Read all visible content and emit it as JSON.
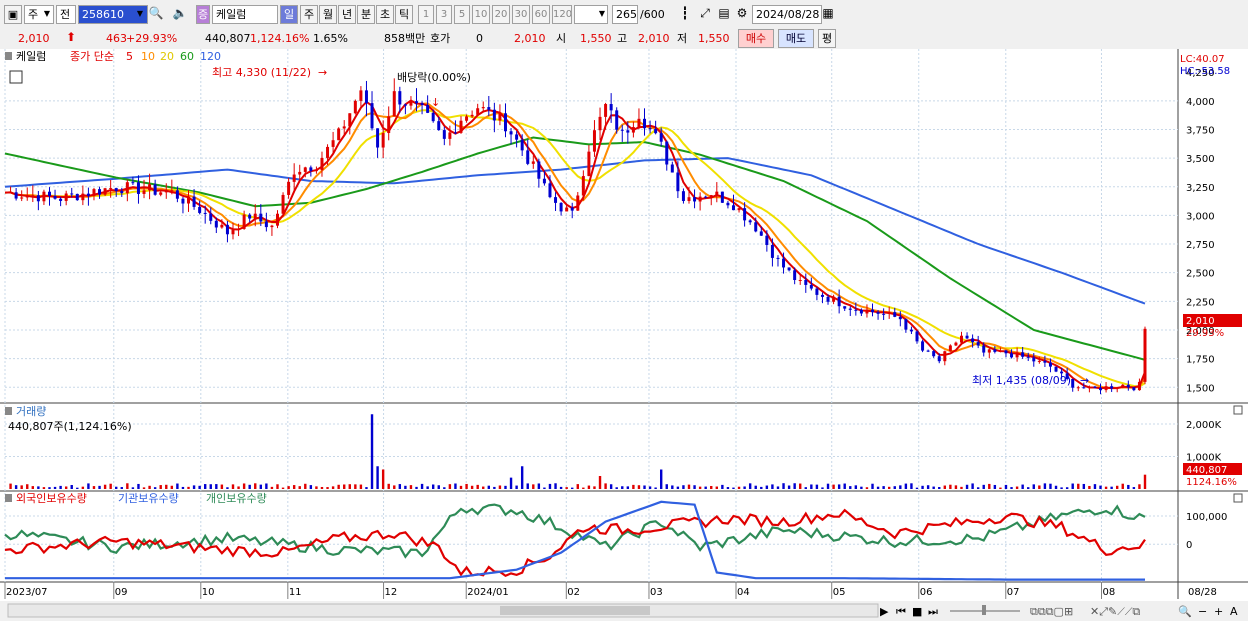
{
  "toolbar": {
    "market": "주",
    "prev_label": "전",
    "code": "258610",
    "stock_badge": "증",
    "stock_name": "케일럼",
    "periods": [
      "일",
      "주",
      "월",
      "년",
      "분",
      "초",
      "틱"
    ],
    "active_period": "일",
    "nums": [
      "1",
      "3",
      "5",
      "10",
      "20",
      "30",
      "60",
      "120"
    ],
    "count": "265",
    "count_total": "/600",
    "date": "2024/08/28"
  },
  "info": {
    "price": "2,010",
    "change": "463",
    "change_pct": "+29.93%",
    "volume": "440,807",
    "volume_pct": "1,124.16%",
    "turnover": "1.65%",
    "amount": "858백만",
    "hoga_label": "호가",
    "hoga_value": "0",
    "hoga_price": "2,010",
    "open_label": "시",
    "open": "1,550",
    "high_label": "고",
    "high": "2,010",
    "low_label": "저",
    "low": "1,550",
    "buy_label": "매수",
    "sell_label": "매도",
    "eval_label": "평"
  },
  "colors": {
    "up": "#e00000",
    "down": "#0000d0",
    "ma5": "#e00000",
    "ma10": "#ff8c00",
    "ma20": "#f0e000",
    "ma60": "#1a9a1a",
    "ma120": "#3060e0",
    "foreign": "#e00000",
    "institution": "#3060e0",
    "individual": "#2e8b57",
    "grid": "#c8d8e8",
    "active": "#6d7bd9"
  },
  "chart_data": {
    "type": "candlestick",
    "price_panel": {
      "stock_label": "케일럼",
      "legend_prefix": "종가 단순",
      "legend": [
        {
          "name": "5",
          "color": "#e00000"
        },
        {
          "name": "10",
          "color": "#ff8c00"
        },
        {
          "name": "20",
          "color": "#e0c800"
        },
        {
          "name": "60",
          "color": "#1a9a1a"
        },
        {
          "name": "120",
          "color": "#3060e0"
        }
      ],
      "y_ticks": [
        1500,
        1750,
        2000,
        2250,
        2500,
        2750,
        3000,
        3250,
        3500,
        3750,
        4000
      ],
      "y_tick_labels": [
        "1,500",
        "1,750",
        "2,000",
        "2,250",
        "2,500",
        "2,750",
        "3,000",
        "3,250",
        "3,500",
        "3,750",
        "4,000",
        "4,250"
      ],
      "ylim": [
        1380,
        4400
      ],
      "lc": "LC:40.07",
      "hc": "HC:-53.58",
      "last_price_label": "2,010",
      "last_change_label": "29.93%",
      "max_note": "최고 4,330 (11/22)",
      "min_note": "최저 1,435 (08/09)",
      "dividend_note": "배당락(0.00%)",
      "close_anchors": [
        [
          0,
          3200
        ],
        [
          10,
          3150
        ],
        [
          20,
          3250
        ],
        [
          30,
          3200
        ],
        [
          35,
          3050
        ],
        [
          40,
          2850
        ],
        [
          44,
          3000
        ],
        [
          48,
          2900
        ],
        [
          52,
          3400
        ],
        [
          56,
          3450
        ],
        [
          60,
          3700
        ],
        [
          64,
          4100
        ],
        [
          67,
          3600
        ],
        [
          70,
          4050
        ],
        [
          75,
          3900
        ],
        [
          79,
          3650
        ],
        [
          82,
          3850
        ],
        [
          85,
          3950
        ],
        [
          90,
          3800
        ],
        [
          94,
          3500
        ],
        [
          98,
          3150
        ],
        [
          102,
          3000
        ],
        [
          105,
          3600
        ],
        [
          108,
          3950
        ],
        [
          111,
          3700
        ],
        [
          114,
          3900
        ],
        [
          118,
          3600
        ],
        [
          122,
          3150
        ],
        [
          127,
          3200
        ],
        [
          131,
          3100
        ],
        [
          135,
          2900
        ],
        [
          139,
          2600
        ],
        [
          143,
          2400
        ],
        [
          147,
          2300
        ],
        [
          152,
          2200
        ],
        [
          157,
          2150
        ],
        [
          161,
          2100
        ],
        [
          165,
          1820
        ],
        [
          168,
          1730
        ],
        [
          172,
          1950
        ],
        [
          176,
          1800
        ],
        [
          180,
          1800
        ],
        [
          184,
          1750
        ],
        [
          188,
          1680
        ],
        [
          192,
          1520
        ],
        [
          195,
          1480
        ],
        [
          198,
          1500
        ],
        [
          201,
          1520
        ],
        [
          203,
          1500
        ],
        [
          204,
          1547
        ],
        [
          205,
          2010
        ]
      ],
      "ma60_anchors": [
        [
          0,
          3540
        ],
        [
          20,
          3330
        ],
        [
          35,
          3200
        ],
        [
          45,
          3080
        ],
        [
          55,
          3110
        ],
        [
          65,
          3230
        ],
        [
          75,
          3380
        ],
        [
          85,
          3540
        ],
        [
          95,
          3680
        ],
        [
          105,
          3620
        ],
        [
          115,
          3640
        ],
        [
          125,
          3530
        ],
        [
          140,
          3300
        ],
        [
          155,
          2950
        ],
        [
          170,
          2450
        ],
        [
          185,
          2000
        ],
        [
          198,
          1830
        ],
        [
          205,
          1740
        ]
      ],
      "ma120_anchors": [
        [
          0,
          3250
        ],
        [
          20,
          3320
        ],
        [
          40,
          3400
        ],
        [
          55,
          3300
        ],
        [
          70,
          3280
        ],
        [
          85,
          3350
        ],
        [
          100,
          3400
        ],
        [
          115,
          3480
        ],
        [
          130,
          3500
        ],
        [
          145,
          3350
        ],
        [
          160,
          3050
        ],
        [
          175,
          2750
        ],
        [
          190,
          2500
        ],
        [
          205,
          2230
        ]
      ]
    },
    "volume_panel": {
      "title": "거래량",
      "last_label": "440,807주(1,124.16%)",
      "y_ticks": [
        1000000,
        2000000
      ],
      "y_tick_labels": [
        "1,000K",
        "2,000K"
      ],
      "ylim": [
        0,
        2400000
      ],
      "last_value_label": "440,807",
      "last_pct_label": "1124.16%",
      "spikes": [
        [
          66,
          2300000
        ],
        [
          67,
          700000
        ],
        [
          68,
          600000
        ],
        [
          91,
          350000
        ],
        [
          93,
          700000
        ],
        [
          107,
          400000
        ],
        [
          118,
          600000
        ],
        [
          205,
          440807
        ]
      ]
    },
    "holding_panel": {
      "series_names": [
        "외국인보유수량",
        "기관보유수량",
        "개인보유수량"
      ],
      "y_ticks": [
        0,
        100000
      ],
      "y_tick_labels": [
        "0",
        "100,000"
      ],
      "ylim": [
        -130000,
        160000
      ],
      "foreign_anchors": [
        [
          0,
          -20000
        ],
        [
          20,
          10000
        ],
        [
          40,
          -20000
        ],
        [
          50,
          -30000
        ],
        [
          60,
          20000
        ],
        [
          70,
          40000
        ],
        [
          78,
          -10000
        ],
        [
          82,
          -100000
        ],
        [
          92,
          -90000
        ],
        [
          98,
          -40000
        ],
        [
          104,
          60000
        ],
        [
          112,
          50000
        ],
        [
          130,
          90000
        ],
        [
          140,
          80000
        ],
        [
          150,
          110000
        ],
        [
          160,
          40000
        ],
        [
          170,
          70000
        ],
        [
          180,
          100000
        ],
        [
          190,
          60000
        ],
        [
          198,
          -20000
        ],
        [
          205,
          0
        ]
      ],
      "institution_anchors": [
        [
          0,
          -120000
        ],
        [
          55,
          -120000
        ],
        [
          80,
          -120000
        ],
        [
          92,
          -90000
        ],
        [
          100,
          -30000
        ],
        [
          108,
          80000
        ],
        [
          118,
          150000
        ],
        [
          124,
          140000
        ],
        [
          128,
          -100000
        ],
        [
          135,
          -120000
        ],
        [
          150,
          -120000
        ],
        [
          180,
          -125000
        ],
        [
          205,
          -125000
        ]
      ],
      "individual_anchors": [
        [
          0,
          40000
        ],
        [
          20,
          -10000
        ],
        [
          40,
          20000
        ],
        [
          60,
          -20000
        ],
        [
          75,
          -30000
        ],
        [
          82,
          130000
        ],
        [
          92,
          120000
        ],
        [
          100,
          60000
        ],
        [
          108,
          -10000
        ],
        [
          118,
          80000
        ],
        [
          125,
          -10000
        ],
        [
          140,
          50000
        ],
        [
          160,
          10000
        ],
        [
          175,
          20000
        ],
        [
          190,
          100000
        ],
        [
          198,
          130000
        ],
        [
          205,
          90000
        ]
      ]
    },
    "x_labels": [
      {
        "label": "2023/07",
        "index": 0
      },
      {
        "label": "09",
        "index": 25
      },
      {
        "label": "10",
        "index": 45
      },
      {
        "label": "11",
        "index": 65
      },
      {
        "label": "12",
        "index": 87
      },
      {
        "label": "2024/01",
        "index": 106
      },
      {
        "label": "02",
        "index": 129
      },
      {
        "label": "03",
        "index": 148
      },
      {
        "label": "04",
        "index": 168
      },
      {
        "label": "05",
        "index": 190
      },
      {
        "label": "06",
        "index": 210
      },
      {
        "label": "07",
        "index": 230
      },
      {
        "label": "08",
        "index": 252
      }
    ],
    "x_axis_end_label": "08/28",
    "num_bars": 265,
    "x_index_max": 270
  }
}
